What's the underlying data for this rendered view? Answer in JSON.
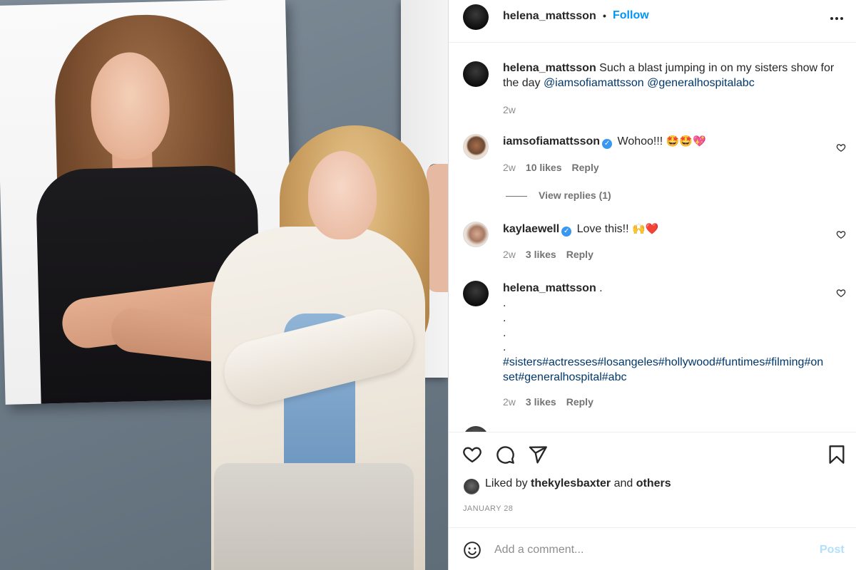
{
  "post": {
    "author": "helena_mattsson",
    "separator": "•",
    "follow_label": "Follow"
  },
  "caption": {
    "username": "helena_mattsson",
    "text": "Such a blast jumping in on my sisters show for the day",
    "mention_1": "@iamsofiamattsson",
    "mention_2": "@generalhospitalabc",
    "time": "2w"
  },
  "comments": [
    {
      "username": "iamsofiamattsson",
      "verified": true,
      "text": "Wohoo!!!",
      "emoji": "🤩🤩💖",
      "time": "2w",
      "likes": "10 likes",
      "reply": "Reply",
      "view_replies": "View replies (1)"
    },
    {
      "username": "kaylaewell",
      "verified": true,
      "text": "Love this!!",
      "emoji": "🙌❤️",
      "time": "2w",
      "likes": "3 likes",
      "reply": "Reply"
    },
    {
      "username": "helena_mattsson",
      "text": ".",
      "dots": [
        ".",
        ".",
        ".",
        "."
      ],
      "hashtags": "#sisters#actresses#losangeles#hollywood#funtimes#filming#onset#generalhospital#abc",
      "time": "2w",
      "likes": "3 likes",
      "reply": "Reply"
    }
  ],
  "likes": {
    "prefix": "Liked by",
    "user": "thekylesbaxter",
    "and": "and",
    "others": "others"
  },
  "date": "JANUARY 28",
  "add_comment": {
    "placeholder": "Add a comment...",
    "post_label": "Post"
  },
  "icons": {
    "more": "more-horizontal-icon",
    "like": "heart-icon",
    "comment": "comment-icon",
    "share": "share-icon",
    "save": "bookmark-icon",
    "emoji": "smile-icon",
    "verified": "verified-badge-icon"
  },
  "colors": {
    "accent": "#0095f6",
    "link": "#00376b",
    "muted": "#8e8e8e",
    "verified": "#3897f0",
    "post_disabled": "#b2dffc"
  }
}
